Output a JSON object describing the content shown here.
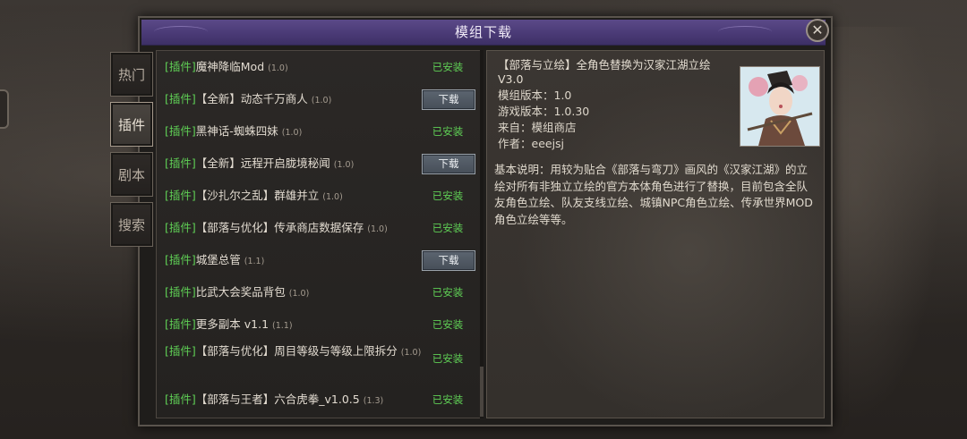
{
  "dialog": {
    "title": "模组下载",
    "close_glyph": "✕"
  },
  "side_tabs": [
    {
      "label": "热门",
      "active": false
    },
    {
      "label": "插件",
      "active": true
    },
    {
      "label": "剧本",
      "active": false
    },
    {
      "label": "搜索",
      "active": false
    }
  ],
  "mod_list": [
    {
      "tag": "[插件]",
      "name": "魔神降临Mod",
      "version": "(1.0)",
      "action": "已安装",
      "action_type": "installed"
    },
    {
      "tag": "[插件]",
      "name": "【全新】动态千万商人",
      "version": "(1.0)",
      "action": "下载",
      "action_type": "download"
    },
    {
      "tag": "[插件]",
      "name": "黑神话-蜘蛛四妹",
      "version": "(1.0)",
      "action": "已安装",
      "action_type": "installed"
    },
    {
      "tag": "[插件]",
      "name": "【全新】远程开启胧境秘闻",
      "version": "(1.0)",
      "action": "下载",
      "action_type": "download"
    },
    {
      "tag": "[插件]",
      "name": "【沙扎尔之乱】群雄并立",
      "version": "(1.0)",
      "action": "已安装",
      "action_type": "installed"
    },
    {
      "tag": "[插件]",
      "name": "【部落与优化】传承商店数据保存",
      "version": "(1.0)",
      "action": "已安装",
      "action_type": "installed"
    },
    {
      "tag": "[插件]",
      "name": "城堡总管",
      "version": "(1.1)",
      "action": "下载",
      "action_type": "download"
    },
    {
      "tag": "[插件]",
      "name": "比武大会奖品背包",
      "version": "(1.0)",
      "action": "已安装",
      "action_type": "installed"
    },
    {
      "tag": "[插件]",
      "name": "更多副本 v1.1",
      "version": "(1.1)",
      "action": "已安装",
      "action_type": "installed"
    },
    {
      "tag": "[插件]",
      "name": "【部落与优化】周目等级与等级上限拆分",
      "version": "(1.0)",
      "action": "已安装",
      "action_type": "installed"
    },
    {
      "tag": "[插件]",
      "name": "【部落与王者】六合虎拳_v1.0.5",
      "version": "(1.3)",
      "action": "已安装",
      "action_type": "installed"
    }
  ],
  "detail": {
    "title": "【部落与立绘】全角色替换为汉家江湖立绘 V3.0",
    "meta": [
      "模组版本：1.0",
      "游戏版本：1.0.30",
      "来自：模组商店",
      "作者：eeejsj"
    ],
    "description": "基本说明：用较为贴合《部落与弯刀》画风的《汉家江湖》的立绘对所有非独立立绘的官方本体角色进行了替换，目前包含全队友角色立绘、队友支线立绘、城镇NPC角色立绘、传承世界MOD角色立绘等等。"
  },
  "colors": {
    "installed": "#5fcf55",
    "title_bar": "#4a3a76",
    "panel": "#2b2826"
  }
}
